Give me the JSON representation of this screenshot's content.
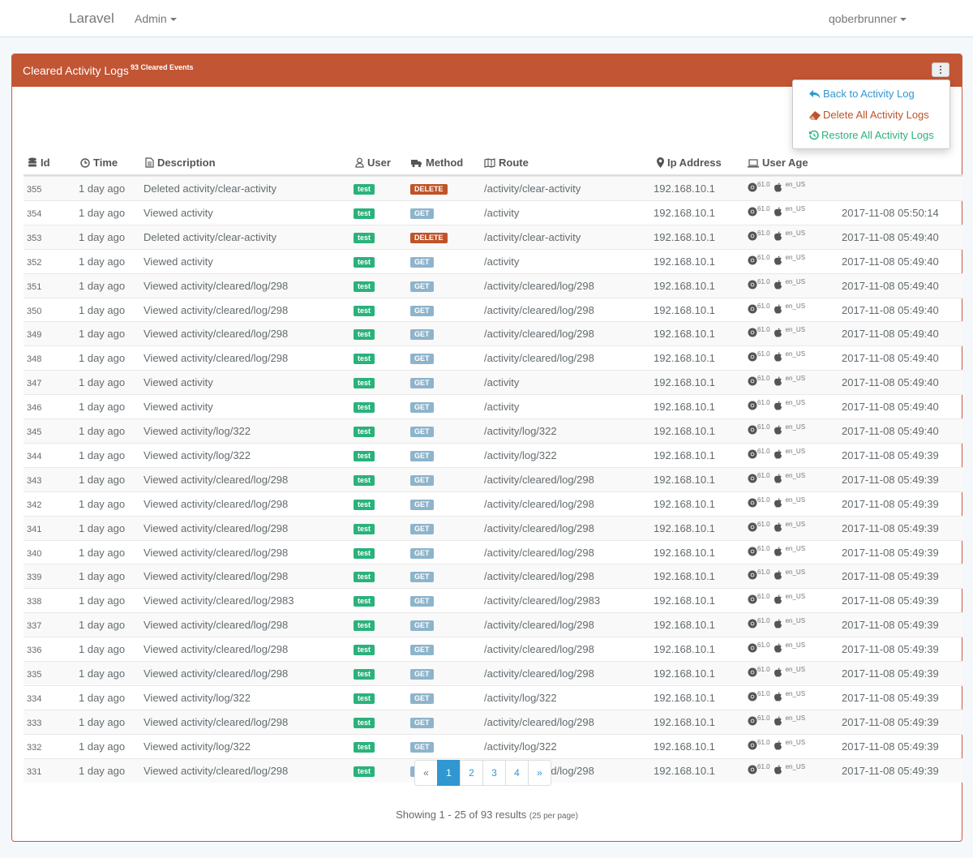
{
  "navbar": {
    "brand": "Laravel",
    "admin_label": "Admin",
    "user_label": "qoberbrunner"
  },
  "panel": {
    "title": "Cleared Activity Logs",
    "badge": "93 Cleared Events"
  },
  "dropdown": {
    "back": "Back to Activity Log",
    "delete": "Delete All Activity Logs",
    "restore": "Restore All Activity Logs"
  },
  "table": {
    "headers": {
      "id": "Id",
      "time": "Time",
      "description": "Description",
      "user": "User",
      "method": "Method",
      "route": "Route",
      "ip": "Ip Address",
      "agent": "User Age"
    },
    "rows": [
      {
        "id": "355",
        "time": "1 day ago",
        "desc": "Deleted activity/clear-activity",
        "user": "test",
        "method": "DELETE",
        "route": "/activity/clear-activity",
        "ip": "192.168.10.1",
        "ver": "61.0",
        "locale": "en_US",
        "date": ""
      },
      {
        "id": "354",
        "time": "1 day ago",
        "desc": "Viewed activity",
        "user": "test",
        "method": "GET",
        "route": "/activity",
        "ip": "192.168.10.1",
        "ver": "61.0",
        "locale": "en_US",
        "date": "2017-11-08 05:50:14"
      },
      {
        "id": "353",
        "time": "1 day ago",
        "desc": "Deleted activity/clear-activity",
        "user": "test",
        "method": "DELETE",
        "route": "/activity/clear-activity",
        "ip": "192.168.10.1",
        "ver": "61.0",
        "locale": "en_US",
        "date": "2017-11-08 05:49:40"
      },
      {
        "id": "352",
        "time": "1 day ago",
        "desc": "Viewed activity",
        "user": "test",
        "method": "GET",
        "route": "/activity",
        "ip": "192.168.10.1",
        "ver": "61.0",
        "locale": "en_US",
        "date": "2017-11-08 05:49:40"
      },
      {
        "id": "351",
        "time": "1 day ago",
        "desc": "Viewed activity/cleared/log/298",
        "user": "test",
        "method": "GET",
        "route": "/activity/cleared/log/298",
        "ip": "192.168.10.1",
        "ver": "61.0",
        "locale": "en_US",
        "date": "2017-11-08 05:49:40"
      },
      {
        "id": "350",
        "time": "1 day ago",
        "desc": "Viewed activity/cleared/log/298",
        "user": "test",
        "method": "GET",
        "route": "/activity/cleared/log/298",
        "ip": "192.168.10.1",
        "ver": "61.0",
        "locale": "en_US",
        "date": "2017-11-08 05:49:40"
      },
      {
        "id": "349",
        "time": "1 day ago",
        "desc": "Viewed activity/cleared/log/298",
        "user": "test",
        "method": "GET",
        "route": "/activity/cleared/log/298",
        "ip": "192.168.10.1",
        "ver": "61.0",
        "locale": "en_US",
        "date": "2017-11-08 05:49:40"
      },
      {
        "id": "348",
        "time": "1 day ago",
        "desc": "Viewed activity/cleared/log/298",
        "user": "test",
        "method": "GET",
        "route": "/activity/cleared/log/298",
        "ip": "192.168.10.1",
        "ver": "61.0",
        "locale": "en_US",
        "date": "2017-11-08 05:49:40"
      },
      {
        "id": "347",
        "time": "1 day ago",
        "desc": "Viewed activity",
        "user": "test",
        "method": "GET",
        "route": "/activity",
        "ip": "192.168.10.1",
        "ver": "61.0",
        "locale": "en_US",
        "date": "2017-11-08 05:49:40"
      },
      {
        "id": "346",
        "time": "1 day ago",
        "desc": "Viewed activity",
        "user": "test",
        "method": "GET",
        "route": "/activity",
        "ip": "192.168.10.1",
        "ver": "61.0",
        "locale": "en_US",
        "date": "2017-11-08 05:49:40"
      },
      {
        "id": "345",
        "time": "1 day ago",
        "desc": "Viewed activity/log/322",
        "user": "test",
        "method": "GET",
        "route": "/activity/log/322",
        "ip": "192.168.10.1",
        "ver": "61.0",
        "locale": "en_US",
        "date": "2017-11-08 05:49:40"
      },
      {
        "id": "344",
        "time": "1 day ago",
        "desc": "Viewed activity/log/322",
        "user": "test",
        "method": "GET",
        "route": "/activity/log/322",
        "ip": "192.168.10.1",
        "ver": "61.0",
        "locale": "en_US",
        "date": "2017-11-08 05:49:39"
      },
      {
        "id": "343",
        "time": "1 day ago",
        "desc": "Viewed activity/cleared/log/298",
        "user": "test",
        "method": "GET",
        "route": "/activity/cleared/log/298",
        "ip": "192.168.10.1",
        "ver": "61.0",
        "locale": "en_US",
        "date": "2017-11-08 05:49:39"
      },
      {
        "id": "342",
        "time": "1 day ago",
        "desc": "Viewed activity/cleared/log/298",
        "user": "test",
        "method": "GET",
        "route": "/activity/cleared/log/298",
        "ip": "192.168.10.1",
        "ver": "61.0",
        "locale": "en_US",
        "date": "2017-11-08 05:49:39"
      },
      {
        "id": "341",
        "time": "1 day ago",
        "desc": "Viewed activity/cleared/log/298",
        "user": "test",
        "method": "GET",
        "route": "/activity/cleared/log/298",
        "ip": "192.168.10.1",
        "ver": "61.0",
        "locale": "en_US",
        "date": "2017-11-08 05:49:39"
      },
      {
        "id": "340",
        "time": "1 day ago",
        "desc": "Viewed activity/cleared/log/298",
        "user": "test",
        "method": "GET",
        "route": "/activity/cleared/log/298",
        "ip": "192.168.10.1",
        "ver": "61.0",
        "locale": "en_US",
        "date": "2017-11-08 05:49:39"
      },
      {
        "id": "339",
        "time": "1 day ago",
        "desc": "Viewed activity/cleared/log/298",
        "user": "test",
        "method": "GET",
        "route": "/activity/cleared/log/298",
        "ip": "192.168.10.1",
        "ver": "61.0",
        "locale": "en_US",
        "date": "2017-11-08 05:49:39"
      },
      {
        "id": "338",
        "time": "1 day ago",
        "desc": "Viewed activity/cleared/log/2983",
        "user": "test",
        "method": "GET",
        "route": "/activity/cleared/log/2983",
        "ip": "192.168.10.1",
        "ver": "61.0",
        "locale": "en_US",
        "date": "2017-11-08 05:49:39"
      },
      {
        "id": "337",
        "time": "1 day ago",
        "desc": "Viewed activity/cleared/log/298",
        "user": "test",
        "method": "GET",
        "route": "/activity/cleared/log/298",
        "ip": "192.168.10.1",
        "ver": "61.0",
        "locale": "en_US",
        "date": "2017-11-08 05:49:39"
      },
      {
        "id": "336",
        "time": "1 day ago",
        "desc": "Viewed activity/cleared/log/298",
        "user": "test",
        "method": "GET",
        "route": "/activity/cleared/log/298",
        "ip": "192.168.10.1",
        "ver": "61.0",
        "locale": "en_US",
        "date": "2017-11-08 05:49:39"
      },
      {
        "id": "335",
        "time": "1 day ago",
        "desc": "Viewed activity/cleared/log/298",
        "user": "test",
        "method": "GET",
        "route": "/activity/cleared/log/298",
        "ip": "192.168.10.1",
        "ver": "61.0",
        "locale": "en_US",
        "date": "2017-11-08 05:49:39"
      },
      {
        "id": "334",
        "time": "1 day ago",
        "desc": "Viewed activity/log/322",
        "user": "test",
        "method": "GET",
        "route": "/activity/log/322",
        "ip": "192.168.10.1",
        "ver": "61.0",
        "locale": "en_US",
        "date": "2017-11-08 05:49:39"
      },
      {
        "id": "333",
        "time": "1 day ago",
        "desc": "Viewed activity/cleared/log/298",
        "user": "test",
        "method": "GET",
        "route": "/activity/cleared/log/298",
        "ip": "192.168.10.1",
        "ver": "61.0",
        "locale": "en_US",
        "date": "2017-11-08 05:49:39"
      },
      {
        "id": "332",
        "time": "1 day ago",
        "desc": "Viewed activity/log/322",
        "user": "test",
        "method": "GET",
        "route": "/activity/log/322",
        "ip": "192.168.10.1",
        "ver": "61.0",
        "locale": "en_US",
        "date": "2017-11-08 05:49:39"
      },
      {
        "id": "331",
        "time": "1 day ago",
        "desc": "Viewed activity/cleared/log/298",
        "user": "test",
        "method": "GET",
        "route": "/activity/cleared/log/298",
        "ip": "192.168.10.1",
        "ver": "61.0",
        "locale": "en_US",
        "date": "2017-11-08 05:49:39"
      }
    ]
  },
  "pagination": {
    "prev": "«",
    "pages": [
      "1",
      "2",
      "3",
      "4"
    ],
    "next": "»",
    "active": "1"
  },
  "results": {
    "text": "Showing 1 - 25 of 93 results",
    "per_page": "(25 per page)"
  },
  "colors": {
    "panel_header": "#c15534",
    "user_label": "#2ab27b",
    "get_label": "#8eb4cb",
    "delete_label": "#bf5329",
    "link": "#3097d1"
  }
}
